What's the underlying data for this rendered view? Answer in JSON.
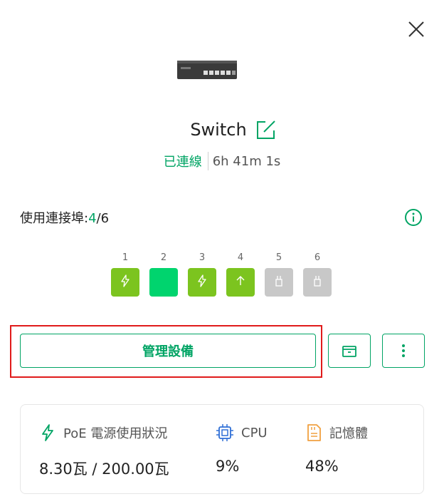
{
  "device": {
    "name": "Switch",
    "status": "已連線",
    "uptime": "6h 41m 1s"
  },
  "ports": {
    "label": "使用連接埠:",
    "used": "4",
    "total_text": "/6",
    "items": [
      {
        "number": "1",
        "state": "poe",
        "color": "#7cc41f",
        "icon": "lightning-icon"
      },
      {
        "number": "2",
        "state": "connected",
        "color": "#00d46e",
        "icon": ""
      },
      {
        "number": "3",
        "state": "poe",
        "color": "#7cc41f",
        "icon": "lightning-icon"
      },
      {
        "number": "4",
        "state": "uplink",
        "color": "#7cc41f",
        "icon": "arrow-up-icon"
      },
      {
        "number": "5",
        "state": "disconnected",
        "color": "#c8c8c8",
        "icon": "ethernet-plug-icon"
      },
      {
        "number": "6",
        "state": "disconnected",
        "color": "#c8c8c8",
        "icon": "ethernet-plug-icon"
      }
    ]
  },
  "actions": {
    "manage_label": "管理設備"
  },
  "stats": {
    "poe": {
      "title": "PoE 電源使用狀況",
      "value": "8.30瓦 / 200.00瓦",
      "icon": "lightning-icon",
      "color": "#00a464"
    },
    "cpu": {
      "title": "CPU",
      "value": "9%",
      "icon": "cpu-chip-icon",
      "color": "#2f6fd6"
    },
    "memory": {
      "title": "記憶體",
      "value": "48%",
      "icon": "memory-card-icon",
      "color": "#f0a040"
    }
  },
  "colors": {
    "accent": "#00a464",
    "highlight": "#e01b1b"
  }
}
